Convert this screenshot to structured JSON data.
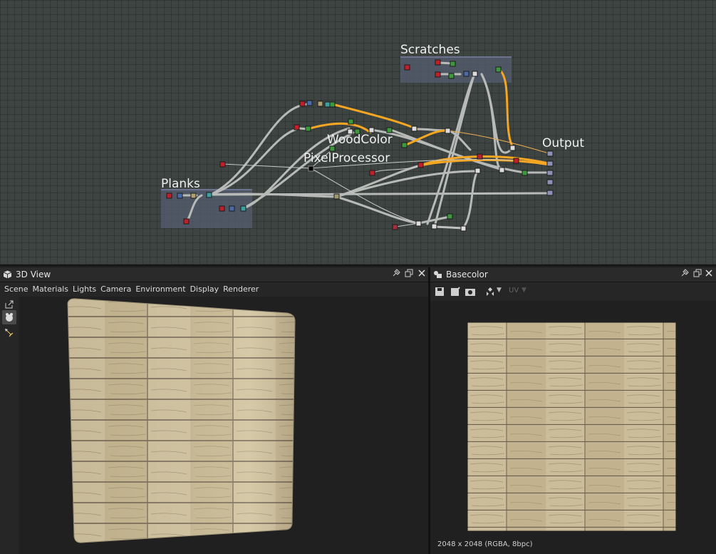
{
  "graph": {
    "frames": [
      {
        "id": "scratches",
        "title": "Scratches"
      },
      {
        "id": "planks",
        "title": "Planks"
      },
      {
        "id": "output",
        "title": "Output"
      },
      {
        "id": "woodcolor",
        "title": "WoodColor"
      },
      {
        "id": "pixelprocessor",
        "title": "PixelProcessor"
      }
    ],
    "colors": {
      "background": "#3d4442",
      "grid": "#333a38",
      "frame": "#5d6478",
      "link": "#b8bab8",
      "link_active": "#f5a623"
    }
  },
  "panel_3d": {
    "title": "3D View",
    "menu": [
      "Scene",
      "Materials",
      "Lights",
      "Camera",
      "Environment",
      "Display",
      "Renderer"
    ],
    "icons": [
      "cube-icon",
      "pin-icon",
      "float-icon",
      "close-icon",
      "export-icon",
      "camera-tool-icon",
      "light-tool-icon"
    ]
  },
  "panel_2d": {
    "title": "Basecolor",
    "toolbar": {
      "uv_label": "UV"
    },
    "status": "2048 x 2048 (RGBA, 8bpc)",
    "icons": [
      "bitmap-icon",
      "pin-icon",
      "float-icon",
      "close-icon",
      "save-icon",
      "export-icon",
      "snapshot-icon",
      "display-mode-icon"
    ]
  }
}
